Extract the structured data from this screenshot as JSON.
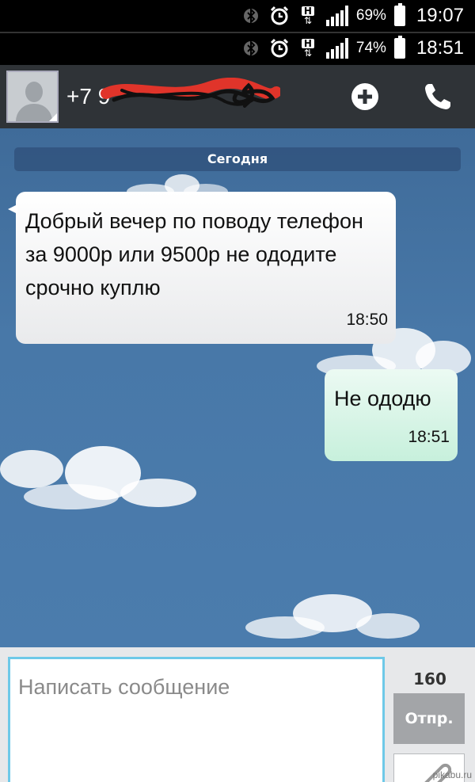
{
  "status_bars": [
    {
      "battery": "69%",
      "time": "19:07"
    },
    {
      "battery": "74%",
      "time": "18:51"
    }
  ],
  "header": {
    "contact": "+7 9",
    "add_icon": "add-circle-icon",
    "call_icon": "phone-icon"
  },
  "chat": {
    "date_label": "Сегодня",
    "messages": [
      {
        "direction": "incoming",
        "text": "Добрый вечер по поводу телефон за 9000р или 9500р не ододите срочно куплю",
        "time": "18:50"
      },
      {
        "direction": "outgoing",
        "text": "Не ододю",
        "time": "18:51"
      }
    ]
  },
  "composer": {
    "placeholder": "Написать сообщение",
    "char_count": "160",
    "send_label": "Отпр."
  },
  "watermark": "pikabu.ru",
  "colors": {
    "chat_bg": "#4878a8",
    "incoming_bubble": "#ffffff",
    "outgoing_bubble": "#c7f0dc",
    "input_border": "#6ec9e8",
    "header_bg": "#2f3337"
  }
}
